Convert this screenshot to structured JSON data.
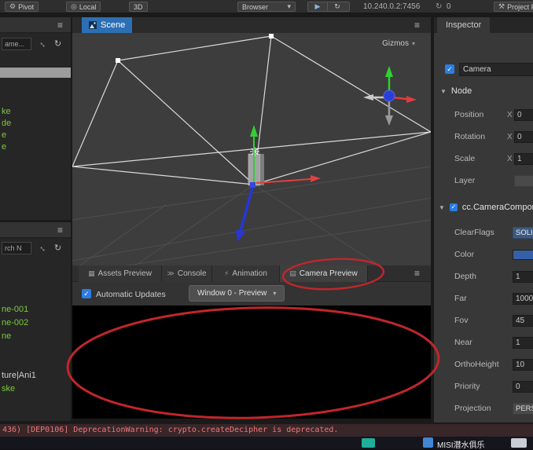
{
  "toolbar": {
    "pivot_label": "Pivot",
    "local_label": "Local",
    "mode_3d_label": "3D",
    "browser_label": "Browser",
    "address": "10.240.0.2:7456",
    "address_count": "0",
    "project_label": "Project F"
  },
  "hierarchy": {
    "search_value": "ame...",
    "items": [
      "ke",
      "de",
      "e",
      "e"
    ]
  },
  "assets": {
    "search_value": "rch N",
    "items": [
      {
        "label": "ne-001"
      },
      {
        "label": "ne-002"
      },
      {
        "label": "ne"
      },
      {
        "label": "ture|Ani1"
      },
      {
        "label": "ske"
      }
    ]
  },
  "scene": {
    "tab_label": "Scene",
    "gizmos_label": "Gizmos"
  },
  "preview": {
    "tabs": [
      {
        "label": "Assets Preview"
      },
      {
        "label": "Console"
      },
      {
        "label": "Animation"
      },
      {
        "label": "Camera Preview"
      }
    ],
    "auto_update_label": "Automatic Updates",
    "window_select_label": "Window 0 - Preview"
  },
  "inspector": {
    "tab_label": "Inspector",
    "name_value": "Camera",
    "node_section_label": "Node",
    "node_rows": [
      {
        "label": "Position",
        "axis": "X",
        "value": "0"
      },
      {
        "label": "Rotation",
        "axis": "X",
        "value": "0"
      },
      {
        "label": "Scale",
        "axis": "X",
        "value": "1"
      },
      {
        "label": "Layer",
        "axis": "",
        "value": ""
      }
    ],
    "component_label": "cc.CameraComponent",
    "props": [
      {
        "label": "ClearFlags",
        "value": "SOLID_COLOR"
      },
      {
        "label": "Color",
        "value": ""
      },
      {
        "label": "Depth",
        "value": "1"
      },
      {
        "label": "Far",
        "value": "1000"
      },
      {
        "label": "Fov",
        "value": "45"
      },
      {
        "label": "Near",
        "value": "1"
      },
      {
        "label": "OrthoHeight",
        "value": "10"
      },
      {
        "label": "Priority",
        "value": "0"
      },
      {
        "label": "Projection",
        "value": "PERSPECTIVE"
      }
    ]
  },
  "statusbar": {
    "message": "436) [DEP0106] DeprecationWarning: crypto.createDecipher is deprecated."
  },
  "taskbar": {
    "app_label": "MISI潜水俱乐"
  },
  "icons": {
    "menu": "≡",
    "gear": "⚙",
    "local": "◎",
    "play": "▶",
    "refresh": "↻",
    "caret_down": "▾",
    "wrench": "⚒",
    "expand": "↔",
    "check": "✓",
    "assets_preview": "▦",
    "console": "≫",
    "animation": "⚡",
    "camera_preview": "▤",
    "collapse_arrow": "▼"
  },
  "colors": {
    "accent_blue": "#2d6fb4",
    "checkbox": "#2b7de0",
    "camera_color": "#3560a8",
    "annotation": "#c0262c",
    "tree_green": "#7cc93f",
    "error_text": "#f07878"
  }
}
